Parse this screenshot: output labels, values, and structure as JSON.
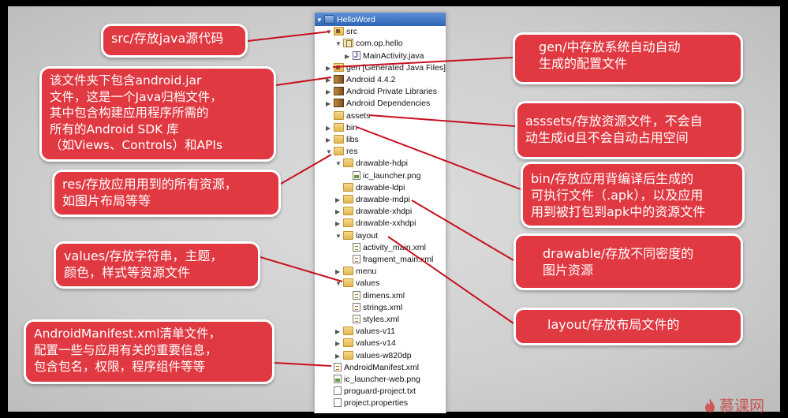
{
  "tree": {
    "items": [
      {
        "label": "HelloWord",
        "icon": "project-icon",
        "twisty": "▼",
        "indent": 0,
        "selected": true
      },
      {
        "label": "src",
        "icon": "source-folder-icon",
        "twisty": "▼",
        "indent": 1
      },
      {
        "label": "com.op.hello",
        "icon": "package-icon",
        "twisty": "▼",
        "indent": 2
      },
      {
        "label": "MainActivity.java",
        "icon": "java-file-icon",
        "twisty": "▶",
        "indent": 3
      },
      {
        "label": "gen [Generated Java Files]",
        "icon": "source-folder-icon",
        "twisty": "▶",
        "indent": 1
      },
      {
        "label": "Android 4.4.2",
        "icon": "library-icon",
        "twisty": "▶",
        "indent": 1
      },
      {
        "label": "Android Private Libraries",
        "icon": "library-icon",
        "twisty": "▶",
        "indent": 1
      },
      {
        "label": "Android Dependencies",
        "icon": "library-icon",
        "twisty": "▶",
        "indent": 1
      },
      {
        "label": "assets",
        "icon": "folder-icon",
        "twisty": "",
        "indent": 1
      },
      {
        "label": "bin",
        "icon": "folder-icon",
        "twisty": "▶",
        "indent": 1
      },
      {
        "label": "libs",
        "icon": "folder-icon",
        "twisty": "▶",
        "indent": 1
      },
      {
        "label": "res",
        "icon": "folder-icon",
        "twisty": "▼",
        "indent": 1
      },
      {
        "label": "drawable-hdpi",
        "icon": "folder-icon",
        "twisty": "▼",
        "indent": 2
      },
      {
        "label": "ic_launcher.png",
        "icon": "png-file-icon",
        "twisty": "",
        "indent": 3
      },
      {
        "label": "drawable-ldpi",
        "icon": "folder-icon",
        "twisty": "",
        "indent": 2
      },
      {
        "label": "drawable-mdpi",
        "icon": "folder-icon",
        "twisty": "▶",
        "indent": 2
      },
      {
        "label": "drawable-xhdpi",
        "icon": "folder-icon",
        "twisty": "▶",
        "indent": 2
      },
      {
        "label": "drawable-xxhdpi",
        "icon": "folder-icon",
        "twisty": "▶",
        "indent": 2
      },
      {
        "label": "layout",
        "icon": "folder-icon",
        "twisty": "▼",
        "indent": 2
      },
      {
        "label": "activity_main.xml",
        "icon": "xml-file-icon",
        "twisty": "",
        "indent": 3
      },
      {
        "label": "fragment_main.xml",
        "icon": "xml-file-icon",
        "twisty": "",
        "indent": 3
      },
      {
        "label": "menu",
        "icon": "folder-icon",
        "twisty": "▶",
        "indent": 2
      },
      {
        "label": "values",
        "icon": "folder-icon",
        "twisty": "▼",
        "indent": 2
      },
      {
        "label": "dimens.xml",
        "icon": "xml-file-icon",
        "twisty": "",
        "indent": 3
      },
      {
        "label": "strings.xml",
        "icon": "xml-file-icon",
        "twisty": "",
        "indent": 3
      },
      {
        "label": "styles.xml",
        "icon": "xml-file-icon",
        "twisty": "",
        "indent": 3
      },
      {
        "label": "values-v11",
        "icon": "folder-icon",
        "twisty": "▶",
        "indent": 2
      },
      {
        "label": "values-v14",
        "icon": "folder-icon",
        "twisty": "▶",
        "indent": 2
      },
      {
        "label": "values-w820dp",
        "icon": "folder-icon",
        "twisty": "▶",
        "indent": 2
      },
      {
        "label": "AndroidManifest.xml",
        "icon": "xml-file-icon",
        "twisty": "",
        "indent": 1
      },
      {
        "label": "ic_launcher-web.png",
        "icon": "png-file-icon",
        "twisty": "",
        "indent": 1
      },
      {
        "label": "proguard-project.txt",
        "icon": "text-file-icon",
        "twisty": "",
        "indent": 1
      },
      {
        "label": "project.properties",
        "icon": "text-file-icon",
        "twisty": "",
        "indent": 1
      }
    ]
  },
  "callouts": {
    "src": [
      "src/存放java源代码"
    ],
    "android_jar": [
      "该文件夹下包含android.jar",
      "文件，这是一个Java归档文件，",
      "其中包含构建应用程序所需的",
      "所有的Android SDK 库",
      "（如Views、Controls）和APIs"
    ],
    "res": [
      "res/存放应用用到的所有资源，",
      "如图片布局等等"
    ],
    "values": [
      "values/存放字符串，主题，",
      "颜色，样式等资源文件"
    ],
    "manifest": [
      "AndroidManifest.xml清单文件，",
      "配置一些与应用有关的重要信息，",
      "包含包名，权限，程序组件等等"
    ],
    "gen": [
      "gen/中存放系统自动自动",
      "生成的配置文件"
    ],
    "assets": [
      "asssets/存放资源文件，不会自",
      "动生成id且不会自动占用空间"
    ],
    "bin": [
      "bin/存放应用背编译后生成的",
      "可执行文件（.apk），以及应用",
      "用到被打包到apk中的资源文件"
    ],
    "drawable": [
      "drawable/存放不同密度的",
      "图片资源"
    ],
    "layout": [
      "layout/存放布局文件的"
    ]
  },
  "logo": {
    "text": "慕课网"
  },
  "colors": {
    "callout_bg": "#e03942",
    "callout_border": "#ffffff",
    "tree_selection": "#2f64b5",
    "line": "#c8101e"
  }
}
